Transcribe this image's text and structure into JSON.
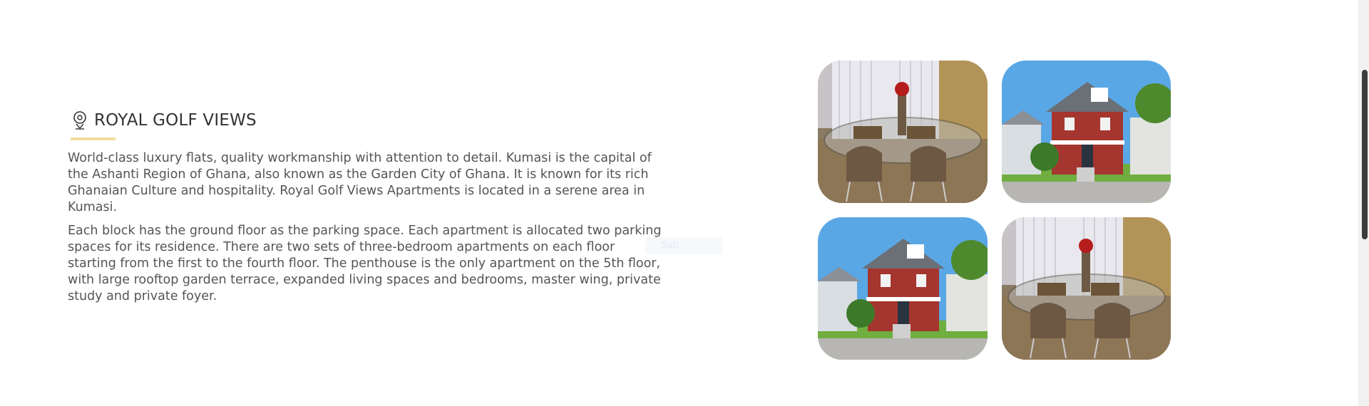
{
  "section": {
    "title": "ROYAL GOLF VIEWS",
    "paragraphs": [
      "World-class luxury flats, quality workmanship with attention to detail. Kumasi is the capital of the Ashanti Region of Ghana, also known as the Garden City of Ghana. It is known for its rich Ghanaian Culture and hospitality. Royal Golf Views Apartments is located in a serene area in Kumasi.",
      "Each block has the ground floor as the parking space. Each apartment is allocated two parking spaces for its residence. There are two sets of three-bedroom apartments on each floor starting from the first to the fourth floor. The penthouse is the only apartment on the 5th floor, with large rooftop garden terrace, expanded living spaces and bedrooms, master wing, private study and private foyer."
    ],
    "faint_label": "Sub",
    "icon": "location-pin-icon",
    "accent_color": "#f0dc9e"
  },
  "gallery": {
    "images": [
      {
        "subject": "dining-room-photo"
      },
      {
        "subject": "red-house-exterior-photo"
      },
      {
        "subject": "red-house-exterior-photo"
      },
      {
        "subject": "dining-room-photo"
      }
    ]
  },
  "scrollbar": {
    "position_fraction": 0.17
  }
}
